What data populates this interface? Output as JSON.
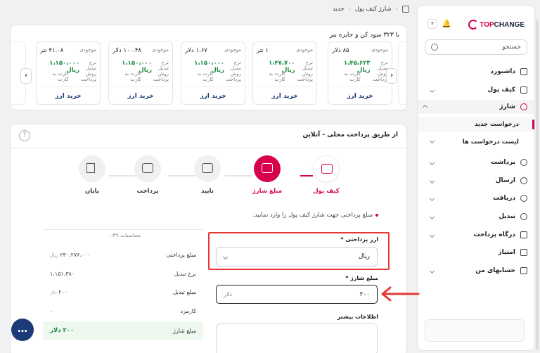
{
  "breadcrumb": {
    "items": [
      "شارژ کیف پول",
      "جدید"
    ]
  },
  "sidebar": {
    "logo_prefix": "TOP",
    "logo_suffix": "CHANGE",
    "notif_count": "۴",
    "search_placeholder": "جستجو",
    "items": [
      {
        "label": "داشبورد",
        "icon": "dashboard-icon"
      },
      {
        "label": "کیف پول",
        "icon": "wallet-icon"
      },
      {
        "label": "شارژ",
        "icon": "plus-circle-icon"
      },
      {
        "label": "برداشت",
        "icon": "minus-circle-icon"
      },
      {
        "label": "ارسال",
        "icon": "send-icon"
      },
      {
        "label": "دریافت",
        "icon": "receive-icon"
      },
      {
        "label": "تبدیل",
        "icon": "exchange-icon"
      },
      {
        "label": "درگاه پرداخت",
        "icon": "gateway-icon"
      },
      {
        "label": "امتیاز",
        "icon": "points-icon"
      },
      {
        "label": "حسابهای من",
        "icon": "bank-icon"
      }
    ],
    "sub": {
      "new": "درخواست جدید",
      "list": "لیست درخواست ها"
    }
  },
  "promo": {
    "title": "با ۳۲۳ سود کن و جایزه ببر",
    "stock_label": "موجودی",
    "rate_label": "نرخ تبدیل",
    "method_label": "روش پرداخت",
    "method_value": "کارت به کارت",
    "buy_label": "خرید ارز",
    "cards": [
      {
        "amount": "۸۵ دلار",
        "rate": "۱،۴۵،۶۲۳ ریال"
      },
      {
        "amount": "۱ تتر",
        "rate": "۱،۴۷،۷۰۰ ریال"
      },
      {
        "amount": "۱.۶۷ دلار",
        "rate": "۱،۱۵۰،۰۰۰ ریال"
      },
      {
        "amount": "۱۰۰.۴۸ دلار",
        "rate": "۱،۱۵۰،۰۰۰ ریال"
      },
      {
        "amount": "۴۱.۰۸ تتر",
        "rate": "۱،۱۵۰،۰۰۰ ریال"
      }
    ]
  },
  "main": {
    "title": "از طریق پرداخت محلی - آنلاین",
    "steps": [
      "کیف پول",
      "مبلغ شارژ",
      "تایید",
      "پرداخت",
      "پایان"
    ],
    "hint": "مبلغ پرداختی جهت شارژ کیف پول را وارد نمایید.",
    "calc": {
      "header": "محاسبات ۰۰:۳۹",
      "rows": [
        {
          "label": "مبلغ پرداختی",
          "value": "۲۳۰،۲۷۶،۰۰۰",
          "unit": "ریال"
        },
        {
          "label": "نرخ تبدیل",
          "value": "۱،۱۵۱،۳۸۰",
          "unit": ""
        },
        {
          "label": "مبلغ تبدیل",
          "value": "۲۰۰",
          "unit": "دلار"
        },
        {
          "label": "کارمزد",
          "value": "۰",
          "unit": ""
        },
        {
          "label": "مبلغ شارژ",
          "value": "۲۰۰ دلار",
          "unit": ""
        }
      ]
    },
    "form": {
      "currency_label": "ارز پرداختی *",
      "currency_value": "ریال",
      "amount_label": "مبلغ شارژ *",
      "amount_value": "۲۰۰",
      "amount_unit": "دلار",
      "extra_label": "اطلاعات بیشتر"
    }
  },
  "colors": {
    "accent": "#d6004c",
    "navy": "#1b3a78",
    "green": "#1a8a3f",
    "highlight": "#e53935"
  }
}
